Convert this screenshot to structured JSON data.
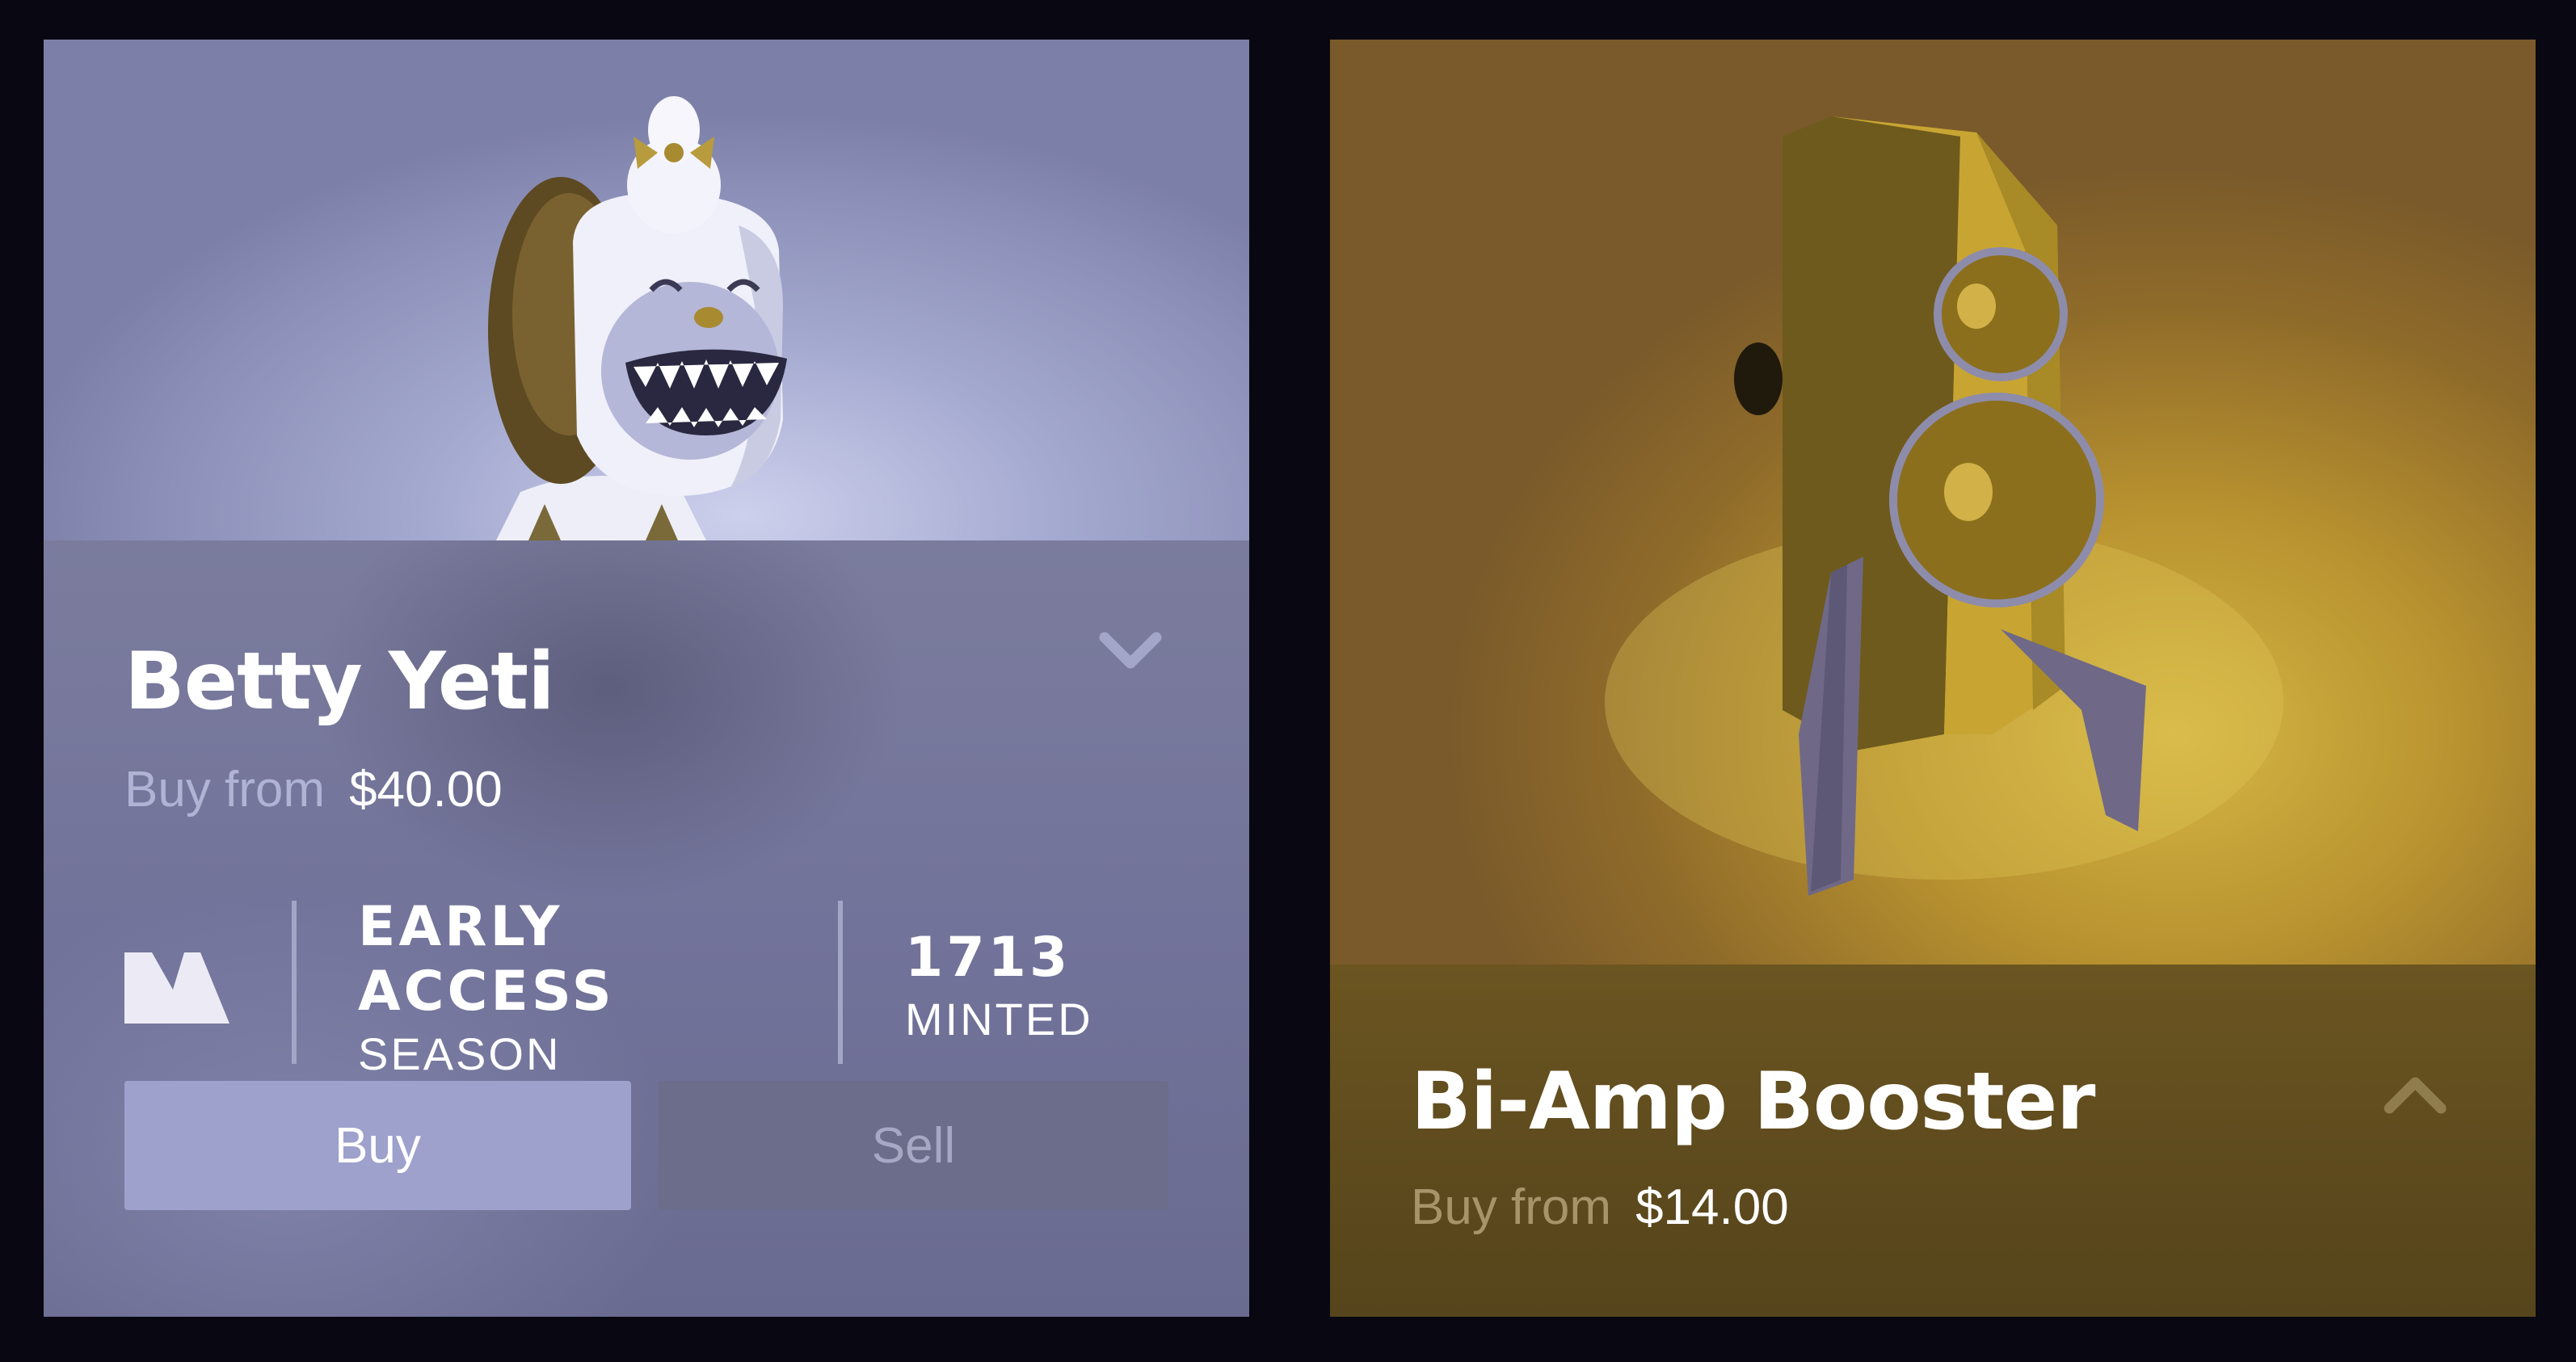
{
  "cards": [
    {
      "name": "Betty Yeti",
      "price_label": "Buy from",
      "price": "$40.00",
      "expanded": true,
      "season_line1": "EARLY",
      "season_line2": "ACCESS",
      "season_line3": "SEASON",
      "minted_count": "1713",
      "minted_label": "MINTED",
      "buy_label": "Buy",
      "sell_label": "Sell",
      "toggle_icon": "chevron-down-icon",
      "label_color": "#b0b3d4"
    },
    {
      "name": "Bi-Amp Booster",
      "price_label": "Buy from",
      "price": "$14.00",
      "expanded": false,
      "toggle_icon": "chevron-up-icon",
      "label_color": "#a7946a"
    }
  ],
  "colors": {
    "page_background": "#090812",
    "yeti_accent": "#9ea1cb",
    "amp_accent": "#c9a73c"
  }
}
